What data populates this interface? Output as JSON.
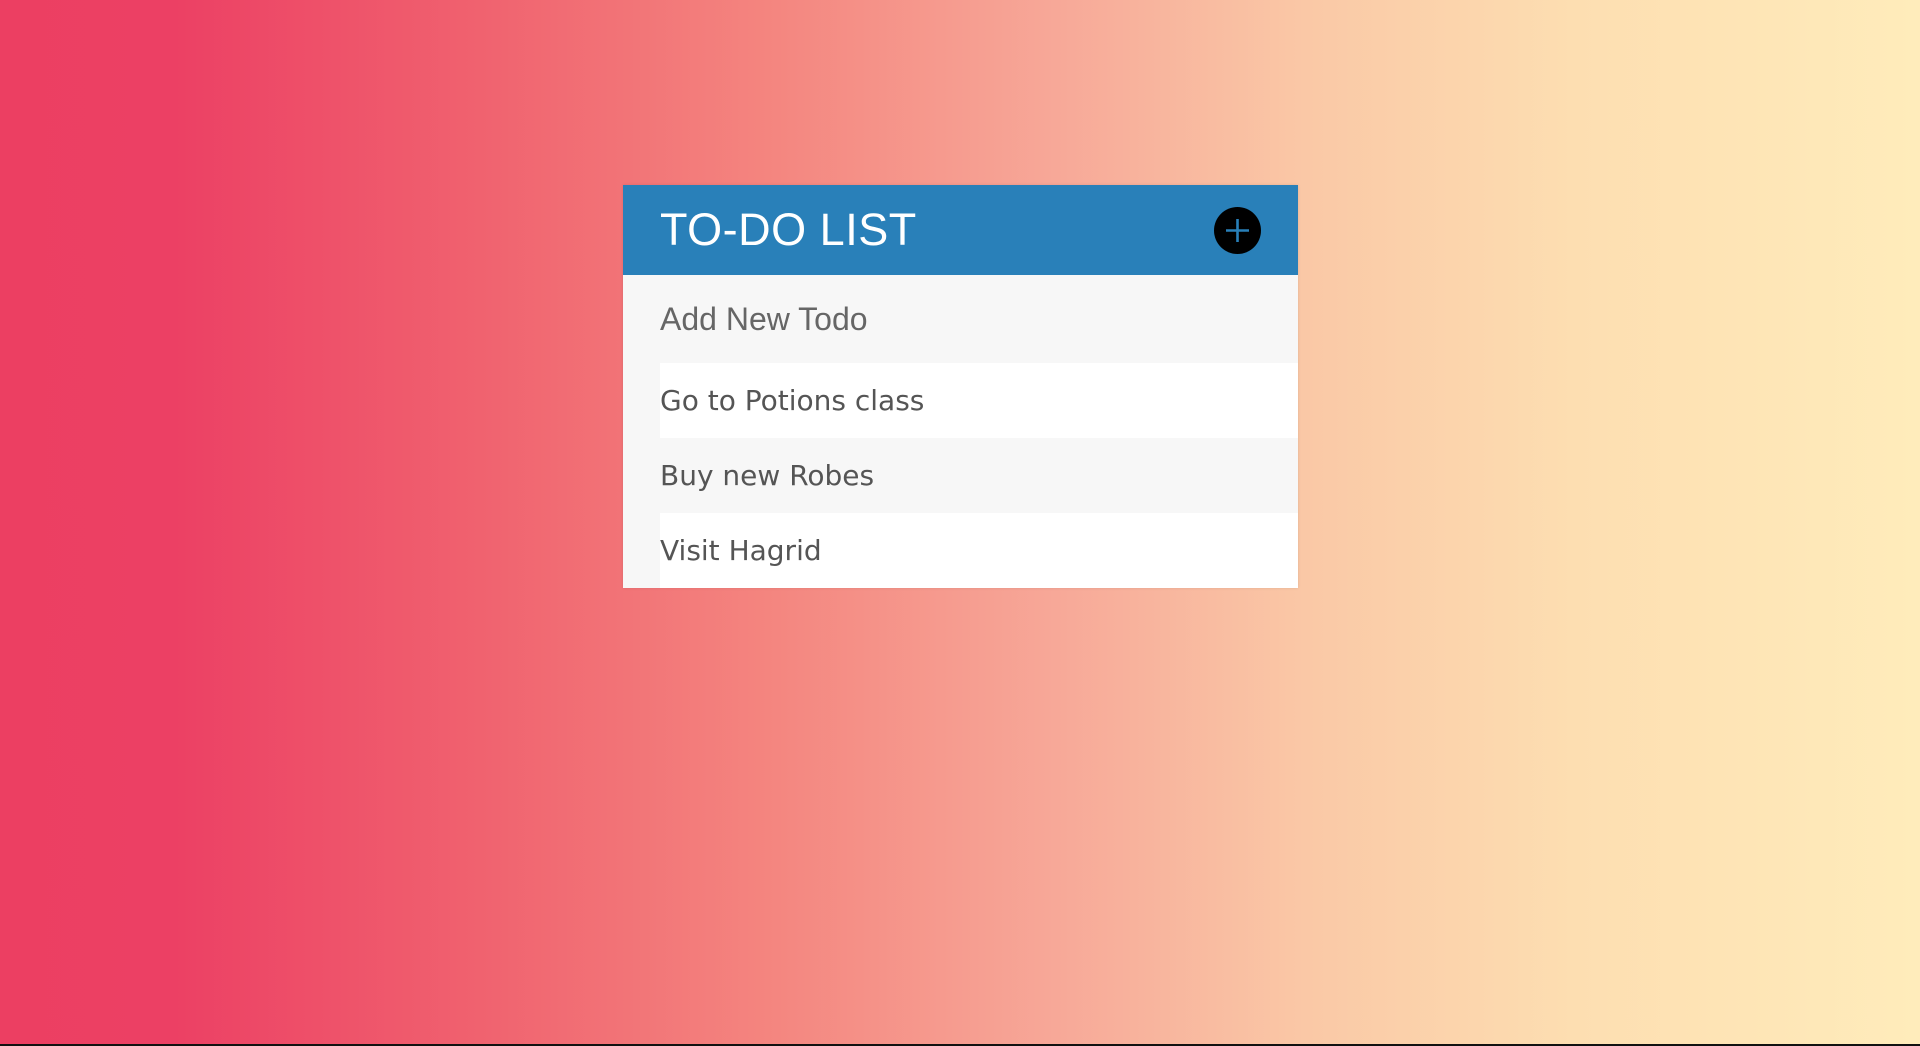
{
  "header": {
    "title": "TO-DO LIST",
    "add_icon": "plus-icon"
  },
  "new_todo": {
    "placeholder": "Add New Todo",
    "value": ""
  },
  "todos": [
    {
      "text": "Go to Potions class"
    },
    {
      "text": "Buy new Robes"
    },
    {
      "text": "Visit Hagrid"
    }
  ],
  "colors": {
    "header_bg": "#2980b9",
    "add_button_bg": "#000000",
    "plus_color": "#2980b9",
    "card_bg": "#f7f7f7",
    "gradient_start": "#ec3f62",
    "gradient_end": "#ffecbb"
  }
}
